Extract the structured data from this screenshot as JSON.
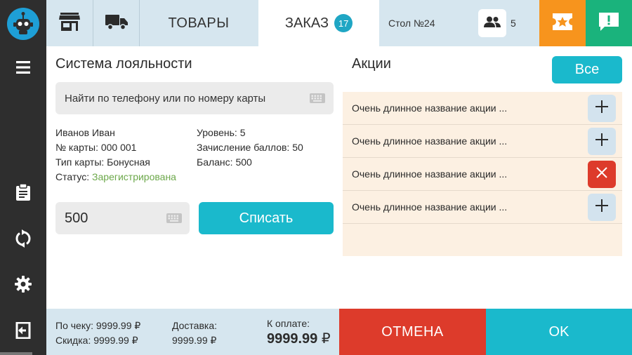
{
  "header": {
    "goods_tab": "ТОВАРЫ",
    "order_tab": "ЗАКАЗ",
    "order_count": "17",
    "table_label": "Стол №24",
    "guests_count": "5"
  },
  "loyalty": {
    "title": "Система лояльности",
    "search_placeholder": "Найти по телефону или по номеру карты",
    "customer": {
      "name": "Иванов Иван",
      "card_number": "№ карты: 000 001",
      "card_type": "Тип карты: Бонусная",
      "status_label": "Статус:",
      "status_value": "Зарегистрирована",
      "level": "Уровень: 5",
      "points_accrual": "Зачисление баллов: 50",
      "balance": "Баланс: 500"
    },
    "points_value": "500",
    "debit_label": "Списать"
  },
  "promotions": {
    "title": "Акции",
    "all_label": "Все",
    "items": [
      {
        "name": "Очень длинное название акции ...",
        "action": "add"
      },
      {
        "name": "Очень длинное название акции ...",
        "action": "add"
      },
      {
        "name": "Очень длинное название акции ...",
        "action": "remove"
      },
      {
        "name": "Очень длинное название акции ...",
        "action": "add"
      }
    ]
  },
  "footer": {
    "check_total": "По чеку: 9999.99 ₽",
    "discount": "Скидка: 9999.99 ₽",
    "delivery_label": "Доставка:",
    "delivery_value": "9999.99 ₽",
    "pay_label": "К оплате:",
    "pay_amount": "9999.99",
    "pay_currency": "₽",
    "cancel_label": "ОТМЕНА",
    "ok_label": "OK"
  },
  "colors": {
    "accent": "#1ab9cc",
    "cancel": "#dd3b2b",
    "promo_button": "#f7941d",
    "message_button": "#1ab37c",
    "status_ok": "#6ca84a"
  },
  "icons": [
    "robot-logo-icon",
    "menu-icon",
    "clipboard-icon",
    "sync-icon",
    "gear-icon",
    "exit-icon",
    "store-icon",
    "truck-icon",
    "users-icon",
    "ticket-star-icon",
    "message-alert-icon",
    "keyboard-icon",
    "plus-icon",
    "close-icon"
  ]
}
